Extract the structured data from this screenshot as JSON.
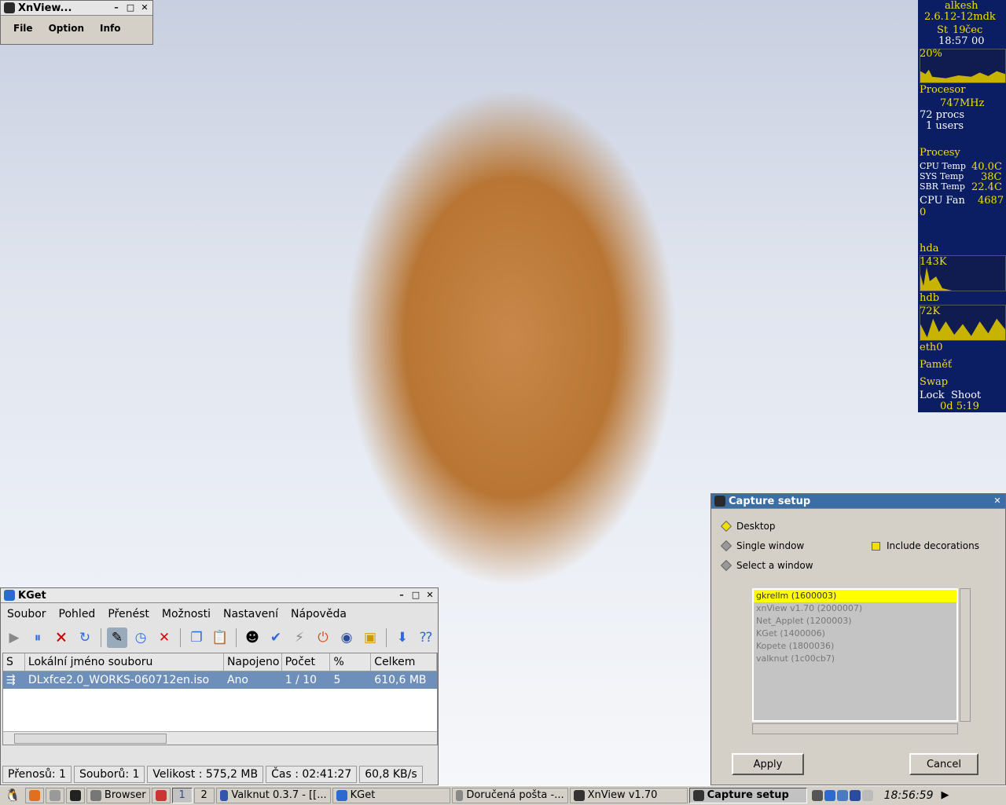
{
  "xnview": {
    "title": "XnView...",
    "menu": [
      "File",
      "Option",
      "Info"
    ]
  },
  "kget": {
    "title": "KGet",
    "menu": [
      "Soubor",
      "Pohled",
      "Přenést",
      "Možnosti",
      "Nastavení",
      "Nápověda"
    ],
    "columns": [
      "S",
      "Lokální jméno souboru",
      "Napojeno",
      "Počet",
      "%",
      "Celkem"
    ],
    "rows": [
      {
        "file": "DLxfce2.0_WORKS-060712en.iso",
        "connected": "Ano",
        "count": "1 / 10",
        "percent": "5",
        "total": "610,6 MB"
      }
    ],
    "status": [
      "Přenosů: 1",
      "Souborů: 1",
      "Velikost : 575,2 MB",
      "Čas : 02:41:27",
      "60,8 KB/s"
    ]
  },
  "capture": {
    "title": "Capture setup",
    "options": {
      "desktop": "Desktop",
      "single": "Single window",
      "select": "Select a window",
      "decorations": "Include decorations"
    },
    "windows": [
      "gkrellm (1600003)",
      "xnView v1.70 (2000007)",
      "Net_Applet (1200003)",
      "KGet (1400006)",
      "Kopete (1800036)",
      "valknut (1c00cb7)"
    ],
    "apply": "Apply",
    "cancel": "Cancel"
  },
  "gkrellm": {
    "host": "alkesh",
    "kernel": "2.6.12-12mdk",
    "date_day": "St",
    "date_num": "19",
    "date_month": "čec",
    "time": "18:57",
    "seconds": "00",
    "cpu_pct": "20%",
    "procesor": "Procesor",
    "freq": "747MHz",
    "procs": "72 procs",
    "users": "1 users",
    "procesy": "Procesy",
    "cpu_temp_label": "CPU Temp",
    "cpu_temp": "40.0C",
    "sys_temp_label": "SYS Temp",
    "sys_temp": "38C",
    "sbr_temp_label": "SBR Temp",
    "sbr_temp": "22.4C",
    "fan_label": "CPU Fan",
    "fan": "4687",
    "fan_zero": "0",
    "hda": "hda",
    "hda_val": "143K",
    "hdb": "hdb",
    "hdb_val": "72K",
    "eth0": "eth0",
    "pamet": "Paměť",
    "swap": "Swap",
    "lock": "Lock",
    "shoot": "Shoot",
    "uptime": "0d  5:19"
  },
  "taskbar": {
    "browser": "Browser",
    "desk1": "1",
    "desk2": "2",
    "tasks": [
      "Valknut 0.3.7 - [[...",
      "KGet",
      "Doručená pošta -...",
      "XnView v1.70",
      "Capture setup"
    ],
    "clock": "18:56:59"
  }
}
